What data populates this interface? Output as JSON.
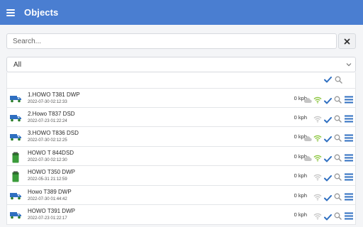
{
  "header": {
    "title": "Objects",
    "menu_icon": "hamburger-menu-icon"
  },
  "search": {
    "placeholder": "Search...",
    "value": "",
    "clear_icon": "close-icon"
  },
  "filter": {
    "selected": "All"
  },
  "colors": {
    "header": "#4a7ed1",
    "check": "#2f6fc1",
    "wifi_active": "#8cc63f",
    "inactive": "#c7c7c7",
    "truck_blue": "#2f6fc1",
    "battery_green": "#3a9b3a"
  },
  "objects": [
    {
      "name": "1.HOWO T381 DWP",
      "time": "2022-07-30 02:12:33",
      "speed": "0 kph",
      "icon": "truck-icon",
      "cloud": true,
      "wifi_active": true
    },
    {
      "name": "2.Howo T837 DSD",
      "time": "2022-07-23 01:22:24",
      "speed": "0 kph",
      "icon": "truck-icon",
      "cloud": false,
      "wifi_active": false
    },
    {
      "name": "3.HOWO T836 DSD",
      "time": "2022-07-30 02:12:25",
      "speed": "0 kph",
      "icon": "truck-icon",
      "cloud": true,
      "wifi_active": true
    },
    {
      "name": "HOWO T 844DSD",
      "time": "2022-07-30 02:12:30",
      "speed": "0 kph",
      "icon": "battery-icon",
      "cloud": true,
      "wifi_active": true
    },
    {
      "name": "HOWO T350 DWP",
      "time": "2022-05-31 21:12:59",
      "speed": "0 kph",
      "icon": "battery-icon",
      "cloud": false,
      "wifi_active": false
    },
    {
      "name": "Howo T389 DWP",
      "time": "2022-07-30 01:44:42",
      "speed": "0 kph",
      "icon": "truck-icon",
      "cloud": false,
      "wifi_active": false
    },
    {
      "name": "HOWO T391 DWP",
      "time": "2022-07-23 01:22:17",
      "speed": "0 kph",
      "icon": "truck-icon",
      "cloud": false,
      "wifi_active": false
    }
  ]
}
